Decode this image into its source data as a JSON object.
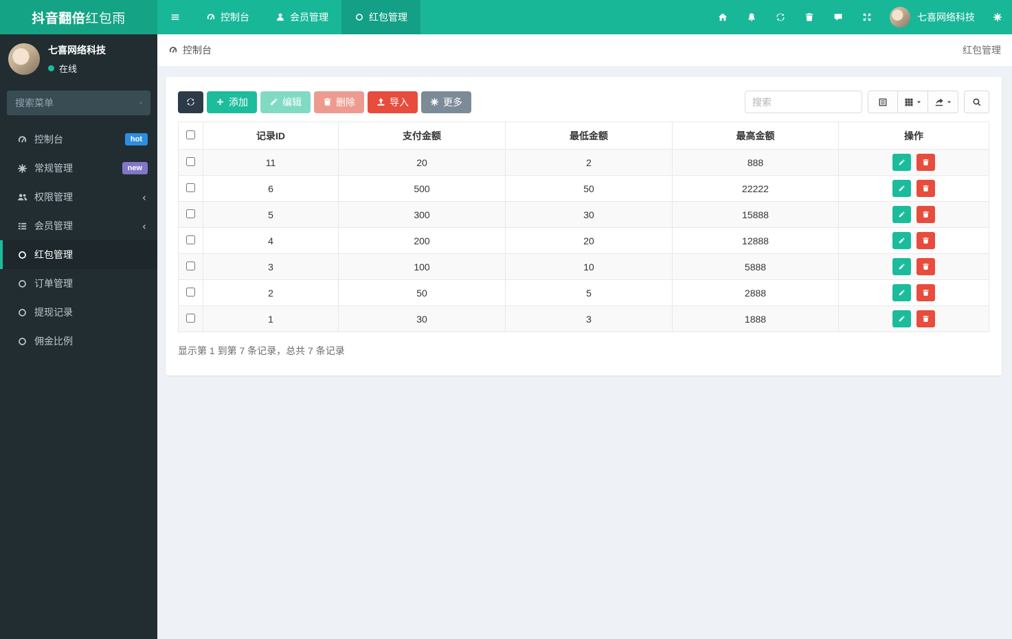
{
  "app": {
    "logo_bold": "抖音翻倍",
    "logo_light": "红包雨"
  },
  "topnav": {
    "items": [
      {
        "label": "控制台"
      },
      {
        "label": "会员管理"
      },
      {
        "label": "红包管理"
      }
    ],
    "right_icons": [
      "home",
      "bell",
      "refresh",
      "trash",
      "chat",
      "expand",
      "cogs"
    ],
    "user_name": "七喜网络科技"
  },
  "sidebar": {
    "user_name": "七喜网络科技",
    "status": "在线",
    "search_placeholder": "搜索菜单",
    "items": [
      {
        "label": "控制台",
        "badge": "hot"
      },
      {
        "label": "常规管理",
        "badge": "new"
      },
      {
        "label": "权限管理"
      },
      {
        "label": "会员管理"
      },
      {
        "label": "红包管理"
      },
      {
        "label": "订单管理"
      },
      {
        "label": "提现记录"
      },
      {
        "label": "佣金比例"
      }
    ]
  },
  "breadcrumb": {
    "left": "控制台",
    "right": "红包管理"
  },
  "toolbar": {
    "add": "添加",
    "edit": "编辑",
    "delete": "删除",
    "import": "导入",
    "more": "更多",
    "search_placeholder": "搜索"
  },
  "table": {
    "columns": {
      "id": "记录ID",
      "pay": "支付金额",
      "min": "最低金额",
      "max": "最高金额",
      "op": "操作"
    },
    "rows": [
      {
        "id": "11",
        "pay": "20",
        "min": "2",
        "max": "888"
      },
      {
        "id": "6",
        "pay": "500",
        "min": "50",
        "max": "22222"
      },
      {
        "id": "5",
        "pay": "300",
        "min": "30",
        "max": "15888"
      },
      {
        "id": "4",
        "pay": "200",
        "min": "20",
        "max": "12888"
      },
      {
        "id": "3",
        "pay": "100",
        "min": "10",
        "max": "5888"
      },
      {
        "id": "2",
        "pay": "50",
        "min": "5",
        "max": "2888"
      },
      {
        "id": "1",
        "pay": "30",
        "min": "3",
        "max": "1888"
      }
    ],
    "footer": "显示第 1 到第 7 条记录，总共 7 条记录"
  },
  "colors": {
    "topbar": "#18b798",
    "topbar_dark": "#15a385",
    "sidebar": "#222d32",
    "accent": "#1abc9c",
    "danger": "#e74c3c",
    "badge_hot": "#2d8de0",
    "badge_new": "#8276c6"
  }
}
